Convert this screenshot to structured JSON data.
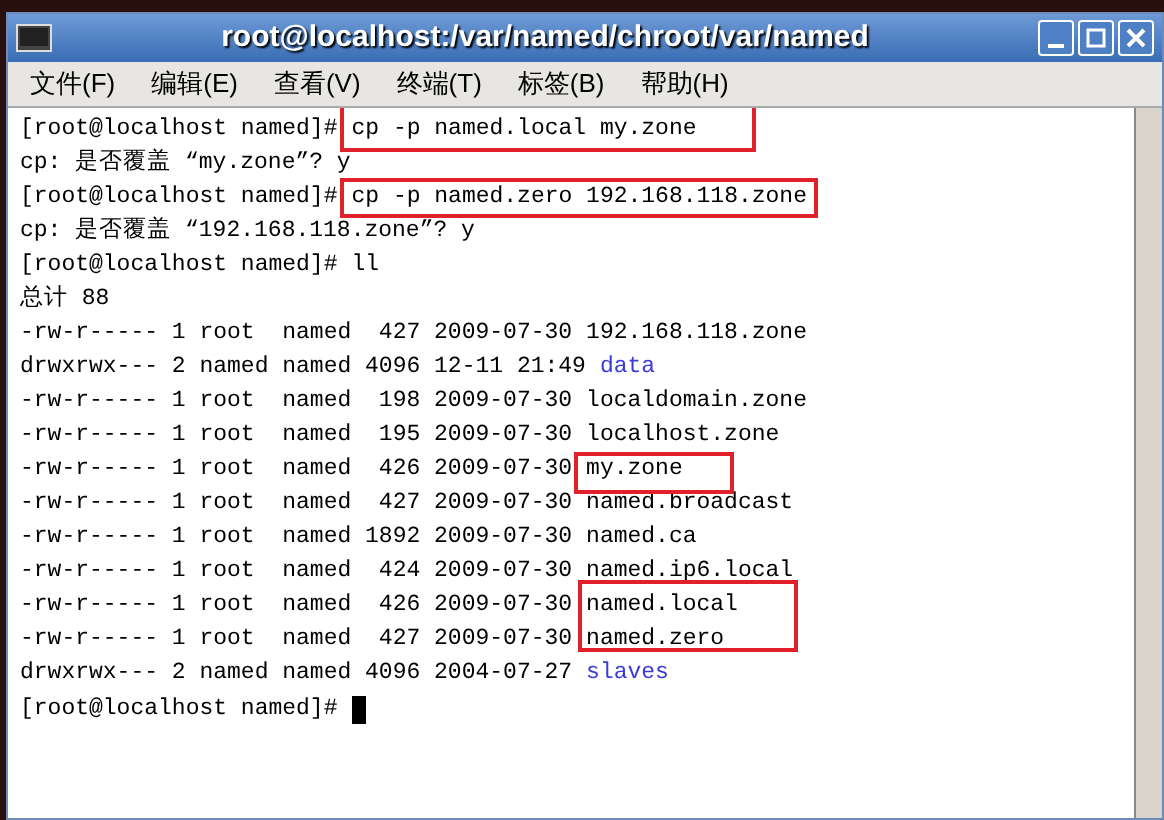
{
  "window": {
    "title": "root@localhost:/var/named/chroot/var/named"
  },
  "menu": [
    "文件(F)",
    "编辑(E)",
    "查看(V)",
    "终端(T)",
    "标签(B)",
    "帮助(H)"
  ],
  "terminal": {
    "lines": [
      {
        "kind": "command",
        "prompt": "[root@localhost named]#",
        "command": "cp -p named.local my.zone",
        "highlighted": true
      },
      {
        "kind": "text",
        "text": "cp: 是否覆盖 “my.zone”? y"
      },
      {
        "kind": "command",
        "prompt": "[root@localhost named]#",
        "command": "cp -p named.zero 192.168.118.zone",
        "highlighted": true
      },
      {
        "kind": "text",
        "text": "cp: 是否覆盖 “192.168.118.zone”? y"
      },
      {
        "kind": "command",
        "prompt": "[root@localhost named]#",
        "command": "ll",
        "highlighted": false
      },
      {
        "kind": "text",
        "text": "总计 88"
      },
      {
        "kind": "entry",
        "prefix": "-rw-r----- 1 root  named  427 2009-07-30",
        "name": "192.168.118.zone",
        "directory": false
      },
      {
        "kind": "entry",
        "prefix": "drwxrwx--- 2 named named 4096 12-11 21:49",
        "name": "data",
        "directory": true
      },
      {
        "kind": "entry",
        "prefix": "-rw-r----- 1 root  named  198 2009-07-30",
        "name": "localdomain.zone",
        "directory": false
      },
      {
        "kind": "entry",
        "prefix": "-rw-r----- 1 root  named  195 2009-07-30",
        "name": "localhost.zone",
        "directory": false
      },
      {
        "kind": "entry",
        "prefix": "-rw-r----- 1 root  named  426 2009-07-30",
        "name": "my.zone",
        "directory": false
      },
      {
        "kind": "entry",
        "prefix": "-rw-r----- 1 root  named  427 2009-07-30",
        "name": "named.broadcast",
        "directory": false
      },
      {
        "kind": "entry",
        "prefix": "-rw-r----- 1 root  named 1892 2009-07-30",
        "name": "named.ca",
        "directory": false
      },
      {
        "kind": "entry",
        "prefix": "-rw-r----- 1 root  named  424 2009-07-30",
        "name": "named.ip6.local",
        "directory": false
      },
      {
        "kind": "entry",
        "prefix": "-rw-r----- 1 root  named  426 2009-07-30",
        "name": "named.local",
        "directory": false
      },
      {
        "kind": "entry",
        "prefix": "-rw-r----- 1 root  named  427 2009-07-30",
        "name": "named.zero",
        "directory": false
      },
      {
        "kind": "entry",
        "prefix": "drwxrwx--- 2 named named 4096 2004-07-27",
        "name": "slaves",
        "directory": true
      },
      {
        "kind": "prompt",
        "text": "[root@localhost named]#"
      }
    ]
  }
}
